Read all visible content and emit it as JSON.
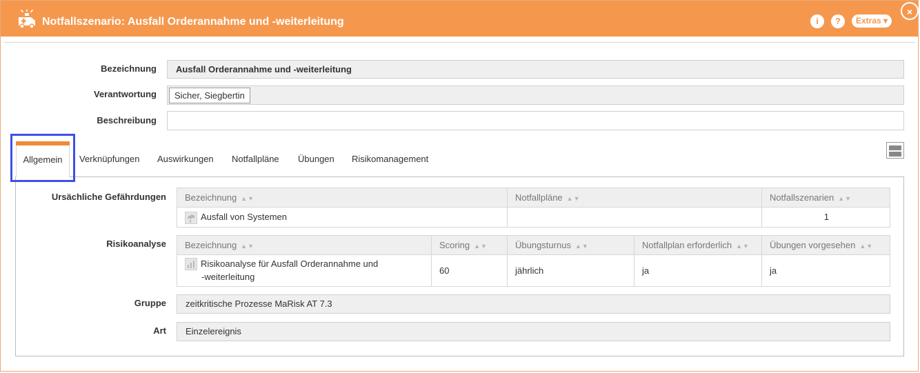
{
  "window": {
    "title": "Notfallszenario: Ausfall Orderannahme und -weiterleitung",
    "app_icon": "ambulance-icon",
    "info_label": "i",
    "help_label": "?",
    "extras_label": "Extras ▾",
    "close_label": "×",
    "accent_color": "#f5984e"
  },
  "fields": {
    "bezeichnung": {
      "label": "Bezeichnung",
      "value": "Ausfall Orderannahme und -weiterleitung"
    },
    "verantwortung": {
      "label": "Verantwortung",
      "value": "Sicher, Siegbertin"
    },
    "beschreibung": {
      "label": "Beschreibung",
      "value": ""
    }
  },
  "tabs": [
    {
      "label": "Allgemein",
      "active": true
    },
    {
      "label": "Verknüpfungen"
    },
    {
      "label": "Auswirkungen"
    },
    {
      "label": "Notfallpläne"
    },
    {
      "label": "Übungen"
    },
    {
      "label": "Risikomanagement"
    }
  ],
  "gefaehrdungen": {
    "label": "Ursächliche Gefährdungen",
    "columns": [
      "Bezeichnung",
      "Notfallpläne",
      "Notfallszenarien"
    ],
    "rows": [
      {
        "bezeichnung": "Ausfall von Systemen",
        "notfallplaene": "",
        "notfallszenarien": "1",
        "icon": "weather-storm-icon"
      }
    ]
  },
  "risikoanalyse": {
    "label": "Risikoanalyse",
    "columns": [
      "Bezeichnung",
      "Scoring",
      "Übungsturnus",
      "Notfallplan erforderlich",
      "Übungen vorgesehen"
    ],
    "rows": [
      {
        "bezeichnung_line1": "Risikoanalyse für Ausfall Orderannahme und",
        "bezeichnung_line2": "-weiterleitung",
        "scoring": "60",
        "uebungsturnus": "jährlich",
        "notfallplan_erforderlich": "ja",
        "uebungen_vorgesehen": "ja",
        "icon": "bar-chart-icon"
      }
    ]
  },
  "gruppe": {
    "label": "Gruppe",
    "value": "zeitkritische Prozesse MaRisk AT 7.3"
  },
  "art": {
    "label": "Art",
    "value": "Einzelereignis"
  }
}
